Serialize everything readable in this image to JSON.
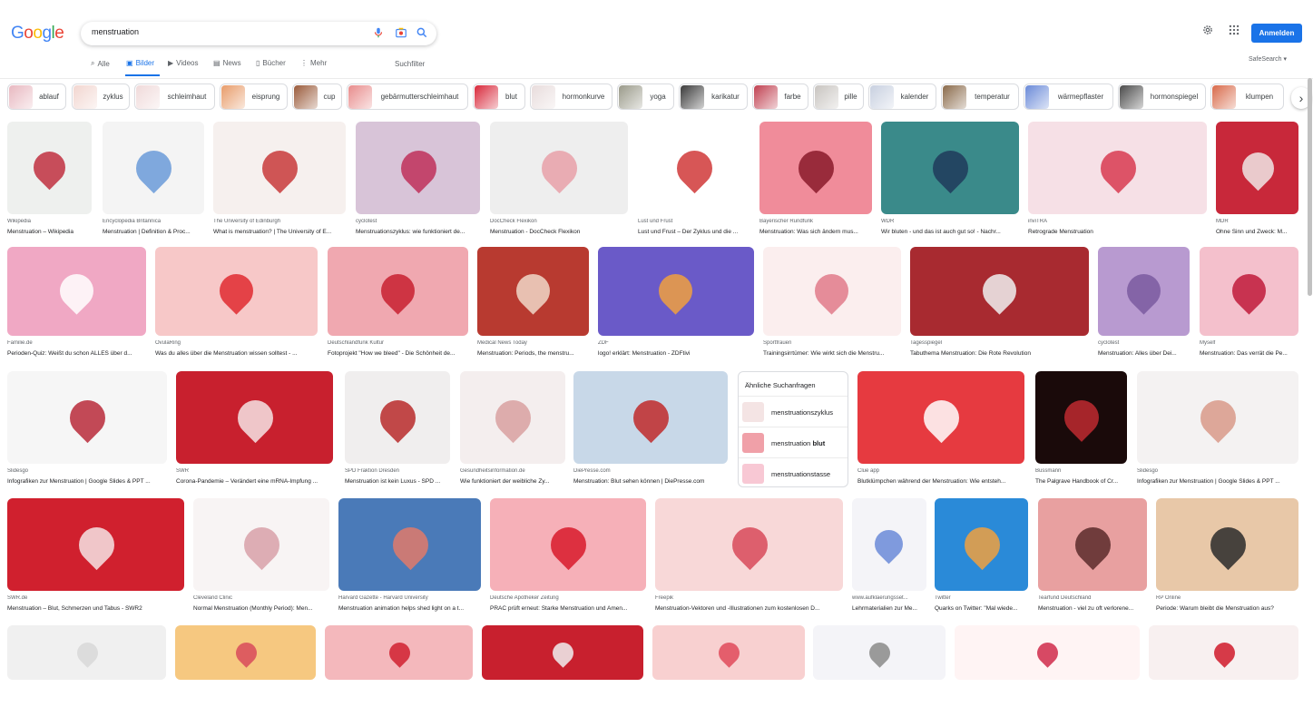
{
  "logo": {
    "letters": [
      "G",
      "o",
      "o",
      "g",
      "l",
      "e"
    ],
    "colors": [
      "#4285f4",
      "#ea4335",
      "#fbbc05",
      "#4285f4",
      "#34a853",
      "#ea4335"
    ]
  },
  "search": {
    "query": "menstruation"
  },
  "tabs": [
    {
      "label": "Alle",
      "icon": "search-icon",
      "active": false
    },
    {
      "label": "Bilder",
      "icon": "image-icon",
      "active": true
    },
    {
      "label": "Videos",
      "icon": "video-icon",
      "active": false
    },
    {
      "label": "News",
      "icon": "news-icon",
      "active": false
    },
    {
      "label": "Bücher",
      "icon": "book-icon",
      "active": false
    },
    {
      "label": "Mehr",
      "icon": "more-icon",
      "active": false
    }
  ],
  "search_tools": "Suchfilter",
  "header_right": {
    "signin": "Anmelden",
    "safesearch": "SafeSearch ▾"
  },
  "accent": "#1a73e8",
  "chips": [
    {
      "label": "ablauf",
      "color": "#e8b8c0"
    },
    {
      "label": "zyklus",
      "color": "#f2d6d0"
    },
    {
      "label": "schleimhaut",
      "color": "#f0dada"
    },
    {
      "label": "eisprung",
      "color": "#e89c6a"
    },
    {
      "label": "cup",
      "color": "#9a5a3a"
    },
    {
      "label": "gebärmutterschleimhaut",
      "color": "#e88c8c"
    },
    {
      "label": "blut",
      "color": "#d8283a"
    },
    {
      "label": "hormonkurve",
      "color": "#e8dcdc"
    },
    {
      "label": "yoga",
      "color": "#9a9a8a"
    },
    {
      "label": "karikatur",
      "color": "#3a3a3a"
    },
    {
      "label": "farbe",
      "color": "#c04050"
    },
    {
      "label": "pille",
      "color": "#c8c4c0"
    },
    {
      "label": "kalender",
      "color": "#c8d0e0"
    },
    {
      "label": "temperatur",
      "color": "#8a6a4a"
    },
    {
      "label": "wärmepflaster",
      "color": "#6a8ad8"
    },
    {
      "label": "hormonspiegel",
      "color": "#4a4a4a"
    },
    {
      "label": "klumpen",
      "color": "#d86a4a"
    }
  ],
  "results": [
    {
      "source": "Wikipedia",
      "title": "Menstruation – Wikipedia",
      "color": "#eef0ee",
      "accent": "#c03040"
    },
    {
      "source": "Encyclopedia Britannica",
      "title": "Menstruation | Definition & Proc...",
      "color": "#f4f4f4",
      "accent": "#6a9ad8"
    },
    {
      "source": "The University of Edinburgh",
      "title": "What is menstruation? | The University of E...",
      "color": "#f6f0ee",
      "accent": "#c83a3a"
    },
    {
      "source": "cyclotest",
      "title": "Menstruationszyklus: wie funktioniert de...",
      "color": "#d8c4d8",
      "accent": "#c0305a"
    },
    {
      "source": "DocCheck Flexikon",
      "title": "Menstruation - DocCheck Flexikon",
      "color": "#eeeeee",
      "accent": "#e8a0a8"
    },
    {
      "source": "Lust und Frust",
      "title": "Lust und Frust – Der Zyklus und die ...",
      "color": "#ffffff",
      "accent": "#d03838"
    },
    {
      "source": "Bayerischer Rundfunk",
      "title": "Menstruation: Was sich ändern mus...",
      "color": "#f08c9a",
      "accent": "#8a1a2a"
    },
    {
      "source": "WDR",
      "title": "Wir bluten - und das ist auch gut so! - Nachr...",
      "color": "#3a8a8a",
      "accent": "#203a5a"
    },
    {
      "source": "inviTRA",
      "title": "Retrograde Menstruation",
      "color": "#f6e0e6",
      "accent": "#d83a50"
    },
    {
      "source": "MDR",
      "title": "Ohne Sinn und Zweck: M...",
      "color": "#c8283a",
      "accent": "#f0e6e6"
    },
    {
      "source": "Familie.de",
      "title": "Perioden-Quiz: Weißt du schon ALLES über d...",
      "color": "#f0a8c4",
      "accent": "#ffffff"
    },
    {
      "source": "OvulaRing",
      "title": "Was du alles über die Menstruation wissen solltest - ...",
      "color": "#f7c8c8",
      "accent": "#e02a30"
    },
    {
      "source": "Deutschlandfunk Kultur",
      "title": "Fotoprojekt \"How we bleed\" - Die Schönheit de...",
      "color": "#f0a8b0",
      "accent": "#c82030"
    },
    {
      "source": "Medical News Today",
      "title": "Menstruation: Periods, the menstru...",
      "color": "#b83a30",
      "accent": "#f0d8c8"
    },
    {
      "source": "ZDF",
      "title": "logo! erklärt: Menstruation - ZDFtivi",
      "color": "#6a5ac8",
      "accent": "#f0a040"
    },
    {
      "source": "Sportfrauen",
      "title": "Trainingsirrtümer: Wie wirkt sich die Menstru...",
      "color": "#fbeeee",
      "accent": "#e07a8a"
    },
    {
      "source": "Tagesspiegel",
      "title": "Tabuthema Menstruation: Die Rote Revolution",
      "color": "#a82a30",
      "accent": "#f0f0f0"
    },
    {
      "source": "cyclotest",
      "title": "Menstruation: Alles über Dei...",
      "color": "#b89ad0",
      "accent": "#7a5aa0"
    },
    {
      "source": "Myself",
      "title": "Menstruation: Das verrät die Pe...",
      "color": "#f4c0cc",
      "accent": "#c01a3a"
    },
    {
      "source": "Slidesgo",
      "title": "Infografiken zur Menstruation | Google Slides & PPT ...",
      "color": "#f6f6f6",
      "accent": "#b82a3a"
    },
    {
      "source": "SWR",
      "title": "Corona-Pandemie – Verändert eine mRNA-Impfung ...",
      "color": "#c8202e",
      "accent": "#f6e4e4"
    },
    {
      "source": "SPD Fraktion Dresden",
      "title": "Menstruation ist kein Luxus - SPD ...",
      "color": "#f0eeee",
      "accent": "#b82a2a"
    },
    {
      "source": "Gesundheitsinformation.de",
      "title": "Wie funktioniert der weibliche Zy...",
      "color": "#f4eeee",
      "accent": "#d8a0a0"
    },
    {
      "source": "DiePresse.com",
      "title": "Menstruation: Blut sehen können | DiePresse.com",
      "color": "#c8d8e8",
      "accent": "#c02a2a"
    },
    {
      "source": "Clue app",
      "title": "Blutklümpchen während der Menstruation: Wie entsteh...",
      "color": "#e63a40",
      "accent": "#ffffff"
    },
    {
      "source": "Bussmann",
      "title": "The Palgrave Handbook of Cr...",
      "color": "#1a0a0a",
      "accent": "#c02a30"
    },
    {
      "source": "Slidesgo",
      "title": "Infografiken zur Menstruation | Google Slides & PPT ...",
      "color": "#f4f2f2",
      "accent": "#d89a8a"
    },
    {
      "source": "SWR.de",
      "title": "Menstruation – Blut, Schmerzen und Tabus - SWR2",
      "color": "#d0202e",
      "accent": "#f6e4e4"
    },
    {
      "source": "Cleveland Clinic",
      "title": "Normal Menstruation (Monthly Period): Men...",
      "color": "#f8f4f4",
      "accent": "#d8a0a8"
    },
    {
      "source": "Harvard Gazette - Harvard University",
      "title": "Menstruation animation helps shed light on a t...",
      "color": "#4a7ab8",
      "accent": "#e07a6a"
    },
    {
      "source": "Deutsche Apotheker Zeitung",
      "title": "PRAC prüft erneut: Starke Menstruation und Amen...",
      "color": "#f6b0b8",
      "accent": "#d81a2a"
    },
    {
      "source": "Freepik",
      "title": "Menstruation-Vektoren und -Illustrationen zum kostenlosen D...",
      "color": "#f8d8d8",
      "accent": "#d84a5a"
    },
    {
      "source": "www.aufklaerungsset...",
      "title": "Lehrmaterialien zur Me...",
      "color": "#f4f4f8",
      "accent": "#6a8ad8"
    },
    {
      "source": "Twitter",
      "title": "Quarks on Twitter: \"Mal wiede...",
      "color": "#2a8ad8",
      "accent": "#f0a040"
    },
    {
      "source": "Tearfund Deutschland",
      "title": "Menstruation - viel zu oft verlorene...",
      "color": "#e8a0a0",
      "accent": "#5a2a2a"
    },
    {
      "source": "RP Online",
      "title": "Periode: Warum bleibt die Menstruation aus?",
      "color": "#e8c8a8",
      "accent": "#2a2a2a"
    },
    {
      "source": "",
      "title": "",
      "color": "#f0f0f0",
      "accent": "#d8d8d8"
    },
    {
      "source": "",
      "title": "",
      "color": "#f6c880",
      "accent": "#d84a5a"
    },
    {
      "source": "",
      "title": "",
      "color": "#f4b8bc",
      "accent": "#d02030"
    },
    {
      "source": "",
      "title": "",
      "color": "#c8202e",
      "accent": "#f0f0f0"
    },
    {
      "source": "",
      "title": "",
      "color": "#f8d0d0",
      "accent": "#e04a5a"
    },
    {
      "source": "",
      "title": "",
      "color": "#f4f4f8",
      "accent": "#8a8a8a"
    },
    {
      "source": "",
      "title": "",
      "color": "#fff4f4",
      "accent": "#d02a4a"
    },
    {
      "source": "",
      "title": "",
      "color": "#f8f0f0",
      "accent": "#d01a2a"
    }
  ],
  "related": {
    "heading": "Ähnliche Suchanfragen",
    "items": [
      {
        "prefix": "menstruationszyklus",
        "bold": "",
        "color": "#f4e4e4"
      },
      {
        "prefix": "menstruation ",
        "bold": "blut",
        "color": "#f0a0a8"
      },
      {
        "prefix": "menstruationstasse",
        "bold": "",
        "color": "#f8c8d4"
      }
    ]
  }
}
